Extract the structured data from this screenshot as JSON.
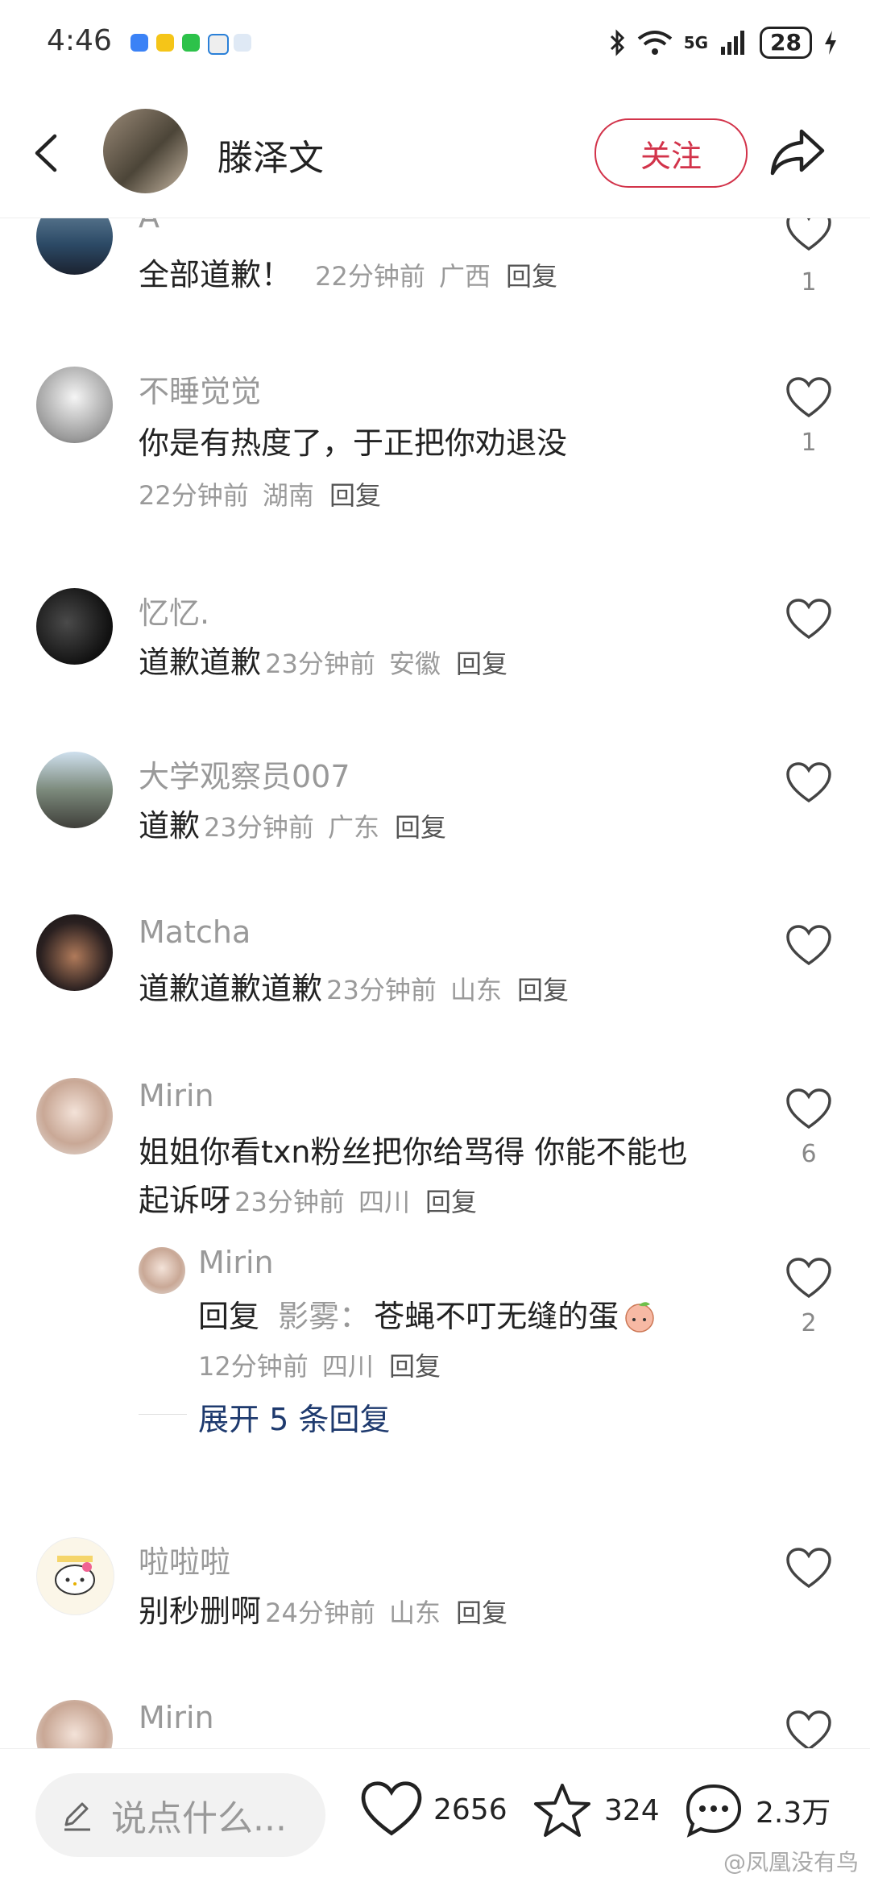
{
  "status_bar": {
    "time": "4:46",
    "network": "5G",
    "battery": "28"
  },
  "header": {
    "username": "滕泽文",
    "follow_label": "关注"
  },
  "comments": [
    {
      "user": "A",
      "text": "全部道歉！",
      "time": "22分钟前",
      "location": "广西",
      "reply": "回复",
      "likes": "1"
    },
    {
      "user": "不睡觉觉",
      "text": "你是有热度了，于正把你劝退没",
      "time": "22分钟前",
      "location": "湖南",
      "reply": "回复",
      "likes": "1"
    },
    {
      "user": "忆忆.",
      "text": "道歉道歉",
      "time": "23分钟前",
      "location": "安徽",
      "reply": "回复",
      "likes": ""
    },
    {
      "user": "大学观察员007",
      "text": "道歉",
      "time": "23分钟前",
      "location": "广东",
      "reply": "回复",
      "likes": ""
    },
    {
      "user": "Matcha",
      "text": "道歉道歉道歉",
      "time": "23分钟前",
      "location": "山东",
      "reply": "回复",
      "likes": ""
    },
    {
      "user": "Mirin",
      "text_line1": "姐姐你看txn粉丝把你给骂得 你能不能也",
      "text_line2": "起诉呀",
      "time": "23分钟前",
      "location": "四川",
      "reply": "回复",
      "likes": "6"
    },
    {
      "user": "啦啦啦",
      "text": "别秒删啊",
      "time": "24分钟前",
      "location": "山东",
      "reply": "回复",
      "likes": ""
    },
    {
      "user": "Mirin"
    }
  ],
  "sub_reply": {
    "user": "Mirin",
    "prefix": "回复",
    "target": "影雾：",
    "text": "苍蝇不叮无缝的蛋",
    "time": "12分钟前",
    "location": "四川",
    "reply": "回复",
    "likes": "2"
  },
  "expand_label": "展开 5 条回复",
  "bottom_bar": {
    "input_placeholder": "说点什么...",
    "like_count": "2656",
    "star_count": "324",
    "comment_count": "2.3万"
  },
  "watermark": "@凤凰没有鸟",
  "colors": {
    "accent": "#d2334a",
    "link": "#1e3a6e"
  }
}
